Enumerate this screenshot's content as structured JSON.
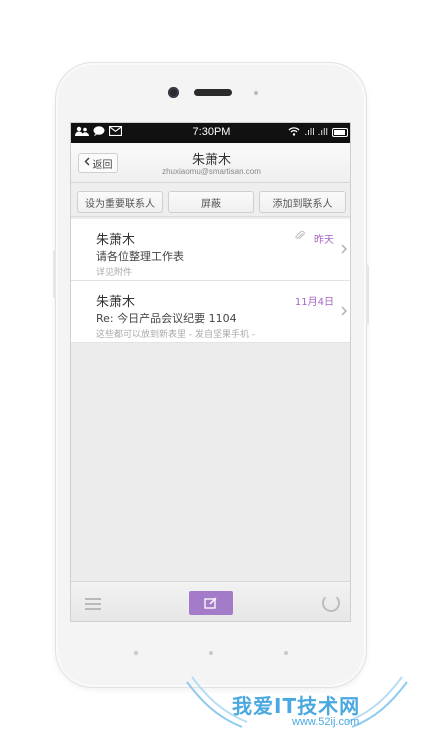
{
  "status_bar": {
    "time": "7:30PM",
    "signal_text": ".ıll .ıll",
    "icons": [
      "contacts-icon",
      "chat-icon",
      "mail-icon",
      "wifi-icon",
      "battery-icon"
    ]
  },
  "header": {
    "back_label": "返回",
    "title": "朱萧木",
    "subtitle": "zhuxiaomu@smartisan.com"
  },
  "actions": {
    "mark_important": "设为重要联系人",
    "block": "屏蔽",
    "add_contact": "添加到联系人"
  },
  "emails": [
    {
      "sender": "朱萧木",
      "subject": "请各位整理工作表",
      "preview": "详见附件",
      "date": "昨天",
      "has_attachment": true
    },
    {
      "sender": "朱萧木",
      "subject": "Re: 今日产品会议纪要 1104",
      "preview": "这些都可以放到新表里 - 发自坚果手机 -",
      "date": "11月4日",
      "has_attachment": false
    }
  ],
  "watermark": {
    "text": "我爱IT技术网",
    "url": "www.52ij.com"
  },
  "colors": {
    "accent": "#a47bc9",
    "date_color": "#a466c4",
    "status_bar": "#111111"
  }
}
